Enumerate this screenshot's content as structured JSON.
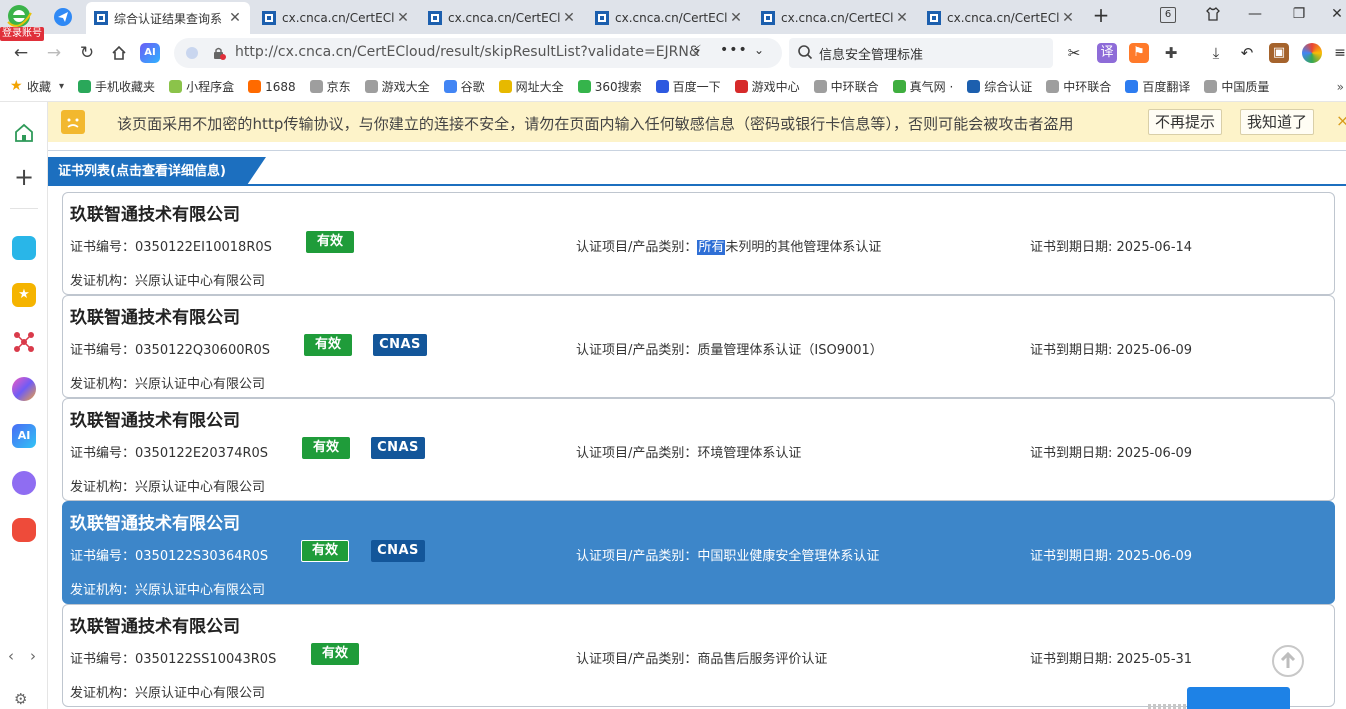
{
  "browser": {
    "login_tag": "登录账号",
    "tab_count": "6",
    "tabs": [
      {
        "title": "综合认证结果查询系",
        "active": true
      },
      {
        "title": "cx.cnca.cn/CertECl",
        "active": false
      },
      {
        "title": "cx.cnca.cn/CertECl",
        "active": false
      },
      {
        "title": "cx.cnca.cn/CertECl",
        "active": false
      },
      {
        "title": "cx.cnca.cn/CertECl",
        "active": false
      },
      {
        "title": "cx.cnca.cn/CertECl",
        "active": false
      }
    ],
    "url": "http://cx.cnca.cn/CertECloud/result/skipResultList?validate=EJRN&",
    "search": {
      "value": "信息安全管理标准",
      "placeholder": ""
    },
    "ai_label": "AI",
    "translate_label": "译"
  },
  "bookmarks": [
    {
      "label": "收藏",
      "color": "#f2a300"
    },
    {
      "label": "手机收藏夹",
      "color": "#2aa85a"
    },
    {
      "label": "小程序盒",
      "color": "#8bc34a"
    },
    {
      "label": "1688",
      "color": "#ff6a00"
    },
    {
      "label": "京东",
      "color": "#9e9e9e"
    },
    {
      "label": "游戏大全",
      "color": "#9e9e9e"
    },
    {
      "label": "谷歌",
      "color": "#4285f4"
    },
    {
      "label": "网址大全",
      "color": "#e7b900"
    },
    {
      "label": "360搜索",
      "color": "#35b44b"
    },
    {
      "label": "百度一下",
      "color": "#2d59e0"
    },
    {
      "label": "游戏中心",
      "color": "#d62a2a"
    },
    {
      "label": "中环联合",
      "color": "#9e9e9e"
    },
    {
      "label": "真气网 ·",
      "color": "#3fae3f"
    },
    {
      "label": "综合认证",
      "color": "#1c5fae"
    },
    {
      "label": "中环联合",
      "color": "#9e9e9e"
    },
    {
      "label": "百度翻译",
      "color": "#2d7cf0"
    },
    {
      "label": "中国质量",
      "color": "#9e9e9e"
    }
  ],
  "bookmarks_more": "»",
  "warning": {
    "text": "该页面采用不加密的http传输协议，与你建立的连接不安全，请勿在页面内输入任何敏感信息（密码或银行卡信息等），否则可能会被攻击者盗用",
    "dismiss_label": "不再提示",
    "ok_label": "我知道了",
    "close": "×"
  },
  "section": {
    "title": "证书列表(点击查看详细信息)"
  },
  "labels": {
    "cert_no": "证书编号：",
    "project": "认证项目/产品类别：",
    "expiry": "证书到期日期: ",
    "issuer": "发证机构："
  },
  "certificates": [
    {
      "company": "玖联智通技术有限公司",
      "cert_no": "0350122EI10018R0S",
      "status": "有效",
      "cnas": "",
      "project_highlight": "所有",
      "project": "未列明的其他管理体系认证",
      "expiry": "2025-06-14",
      "issuer": "兴原认证中心有限公司",
      "selected": false
    },
    {
      "company": "玖联智通技术有限公司",
      "cert_no": "0350122Q30600R0S",
      "status": "有效",
      "cnas": "CNAS",
      "project_highlight": "",
      "project": "质量管理体系认证（ISO9001）",
      "expiry": "2025-06-09",
      "issuer": "兴原认证中心有限公司",
      "selected": false
    },
    {
      "company": "玖联智通技术有限公司",
      "cert_no": "0350122E20374R0S",
      "status": "有效",
      "cnas": "CNAS",
      "project_highlight": "",
      "project": "环境管理体系认证",
      "expiry": "2025-06-09",
      "issuer": "兴原认证中心有限公司",
      "selected": false
    },
    {
      "company": "玖联智通技术有限公司",
      "cert_no": "0350122S30364R0S",
      "status": "有效",
      "cnas": "CNAS",
      "project_highlight": "",
      "project": "中国职业健康安全管理体系认证",
      "expiry": "2025-06-09",
      "issuer": "兴原认证中心有限公司",
      "selected": true
    },
    {
      "company": "玖联智通技术有限公司",
      "cert_no": "0350122SS10043R0S",
      "status": "有效",
      "cnas": "",
      "project_highlight": "",
      "project": "商品售后服务评价认证",
      "expiry": "2025-05-31",
      "issuer": "兴原认证中心有限公司",
      "selected": false
    }
  ],
  "colors": {
    "accent": "#1c6fbf",
    "valid_badge": "#1f9c3a",
    "cnas_badge": "#13569a",
    "selected_row": "#3d86c9",
    "warning_bg": "#fdf3c9"
  }
}
